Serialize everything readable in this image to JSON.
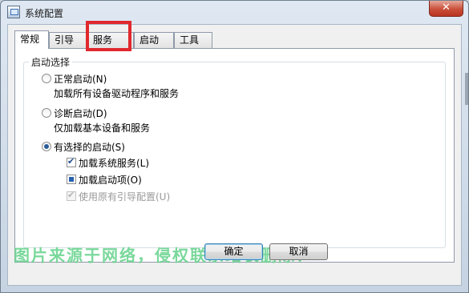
{
  "window": {
    "title": "系统配置",
    "close_label": "✕"
  },
  "tabs": [
    {
      "label": "常规",
      "active": true
    },
    {
      "label": "引导",
      "active": false
    },
    {
      "label": "服务",
      "active": false
    },
    {
      "label": "启动",
      "active": false
    },
    {
      "label": "工具",
      "active": false
    }
  ],
  "startup_selection": {
    "group_label": "启动选择",
    "options": [
      {
        "label": "正常启动(N)",
        "description": "加载所有设备驱动程序和服务",
        "selected": false
      },
      {
        "label": "诊断启动(D)",
        "description": "仅加载基本设备和服务",
        "selected": false
      },
      {
        "label": "有选择的启动(S)",
        "selected": true
      }
    ],
    "sub_options": [
      {
        "label": "加载系统服务(L)",
        "state": "checked",
        "enabled": true
      },
      {
        "label": "加载启动项(O)",
        "state": "indeterminate",
        "enabled": true
      },
      {
        "label": "使用原有引导配置(U)",
        "state": "checked",
        "enabled": false
      }
    ]
  },
  "watermark": "图片来源于网络，侵权联系站长删除！",
  "buttons": {
    "ok": "确定",
    "cancel": "取消"
  },
  "colors": {
    "highlight": "#e0282d",
    "watermark": "#63d28a",
    "close_button": "#c94f39"
  }
}
